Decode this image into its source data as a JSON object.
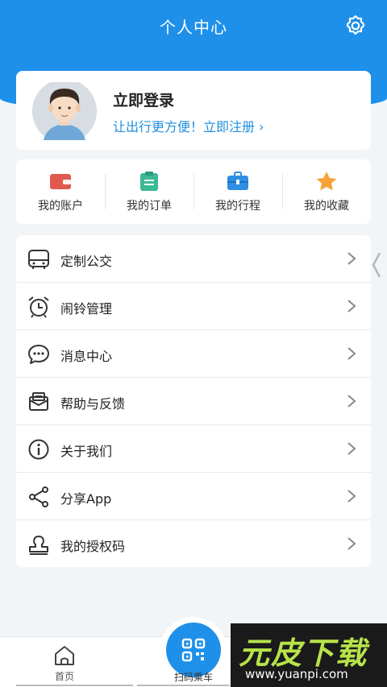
{
  "header": {
    "title": "个人中心",
    "settings_icon": "gear-icon"
  },
  "profile": {
    "title": "立即登录",
    "subtitle": "让出行更方便！立即注册 ›"
  },
  "quick_actions": [
    {
      "label": "我的账户",
      "icon": "wallet-icon",
      "color": "#e05a4f"
    },
    {
      "label": "我的订单",
      "icon": "clipboard-icon",
      "color": "#3db896"
    },
    {
      "label": "我的行程",
      "icon": "briefcase-icon",
      "color": "#2f8fe3"
    },
    {
      "label": "我的收藏",
      "icon": "star-icon",
      "color": "#f5a23a"
    }
  ],
  "menu": [
    {
      "label": "定制公交",
      "icon": "bus-icon"
    },
    {
      "label": "闹铃管理",
      "icon": "alarm-clock-icon"
    },
    {
      "label": "消息中心",
      "icon": "chat-bubble-icon"
    },
    {
      "label": "帮助与反馈",
      "icon": "envelope-icon"
    },
    {
      "label": "关于我们",
      "icon": "info-icon"
    },
    {
      "label": "分享App",
      "icon": "share-icon"
    },
    {
      "label": "我的授权码",
      "icon": "stamp-icon"
    }
  ],
  "tabbar": {
    "home_label": "首页",
    "scan_label": "扫码乘车"
  },
  "watermark": {
    "title": "元皮下载",
    "url": "www.yuanpi.com"
  },
  "colors": {
    "primary": "#1e90ea",
    "background": "#f2f5f8"
  }
}
